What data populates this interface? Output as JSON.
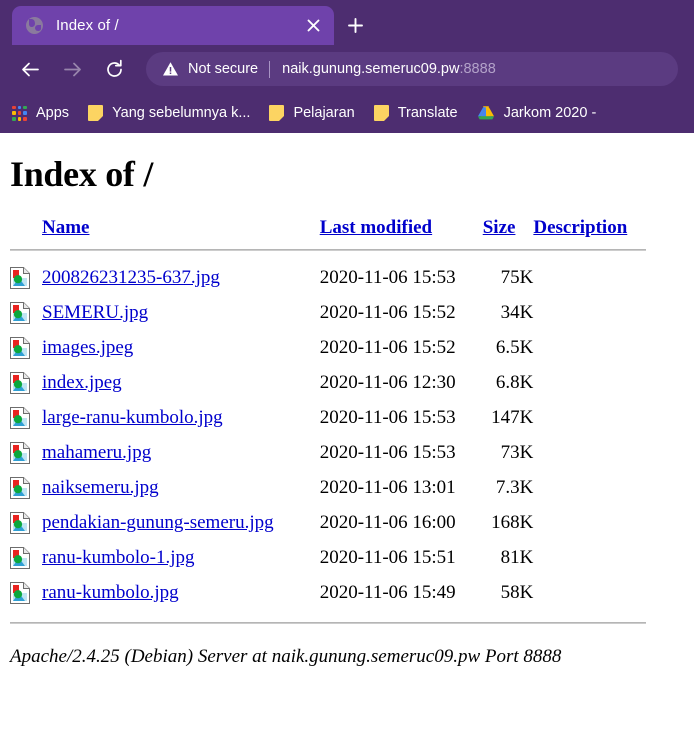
{
  "browser": {
    "tab": {
      "title": "Index of /",
      "favicon": "globe-icon",
      "close_label": "×"
    },
    "new_tab_label": "+",
    "nav": {
      "back_label": "←",
      "forward_label": "→",
      "reload_label": "⟳"
    },
    "omnibox": {
      "security_icon": "warning-triangle-icon",
      "security_text": "Not secure",
      "url_host": "naik.gunung.semeruc09.pw",
      "url_port": ":8888"
    },
    "bookmarks": [
      {
        "label": "Apps",
        "icon": "apps-grid-icon"
      },
      {
        "label": "Yang sebelumnya k...",
        "icon": "folder-icon"
      },
      {
        "label": "Pelajaran",
        "icon": "folder-icon"
      },
      {
        "label": "Translate",
        "icon": "folder-icon"
      },
      {
        "label": "Jarkom 2020 -",
        "icon": "google-drive-icon"
      }
    ]
  },
  "page": {
    "title": "Index of /",
    "columns": {
      "name": "Name",
      "last_modified": "Last modified",
      "size": "Size",
      "description": "Description"
    },
    "rows": [
      {
        "icon": "image-file-icon",
        "name": "200826231235-637.jpg",
        "last_modified": "2020-11-06 15:53",
        "size": "75K",
        "description": ""
      },
      {
        "icon": "image-file-icon",
        "name": "SEMERU.jpg",
        "last_modified": "2020-11-06 15:52",
        "size": "34K",
        "description": ""
      },
      {
        "icon": "image-file-icon",
        "name": "images.jpeg",
        "last_modified": "2020-11-06 15:52",
        "size": "6.5K",
        "description": ""
      },
      {
        "icon": "image-file-icon",
        "name": "index.jpeg",
        "last_modified": "2020-11-06 12:30",
        "size": "6.8K",
        "description": ""
      },
      {
        "icon": "image-file-icon",
        "name": "large-ranu-kumbolo.jpg",
        "last_modified": "2020-11-06 15:53",
        "size": "147K",
        "description": ""
      },
      {
        "icon": "image-file-icon",
        "name": "mahameru.jpg",
        "last_modified": "2020-11-06 15:53",
        "size": "73K",
        "description": ""
      },
      {
        "icon": "image-file-icon",
        "name": "naiksemeru.jpg",
        "last_modified": "2020-11-06 13:01",
        "size": "7.3K",
        "description": ""
      },
      {
        "icon": "image-file-icon",
        "name": "pendakian-gunung-semeru.jpg",
        "last_modified": "2020-11-06 16:00",
        "size": "168K",
        "description": ""
      },
      {
        "icon": "image-file-icon",
        "name": "ranu-kumbolo-1.jpg",
        "last_modified": "2020-11-06 15:51",
        "size": "81K",
        "description": ""
      },
      {
        "icon": "image-file-icon",
        "name": "ranu-kumbolo.jpg",
        "last_modified": "2020-11-06 15:49",
        "size": "58K",
        "description": ""
      }
    ],
    "footer": "Apache/2.4.25 (Debian) Server at naik.gunung.semeruc09.pw Port 8888"
  },
  "colors": {
    "chrome_dark_purple": "#4d2d70",
    "chrome_tab_purple": "#6f42ab",
    "omnibox_purple": "#5b3b81",
    "link_blue": "#0000cc",
    "page_background": "#ffffff"
  }
}
